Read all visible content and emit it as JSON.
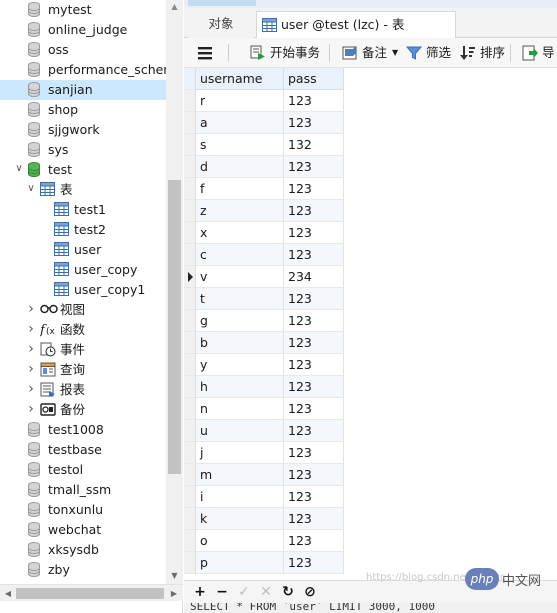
{
  "navigator": {
    "nodes": [
      {
        "label": "mytest",
        "icon": "database-icon",
        "level": 0
      },
      {
        "label": "online_judge",
        "icon": "database-icon",
        "level": 0
      },
      {
        "label": "oss",
        "icon": "database-icon",
        "level": 0
      },
      {
        "label": "performance_schen",
        "icon": "database-icon",
        "level": 0
      },
      {
        "label": "sanjian",
        "icon": "database-icon",
        "level": 0,
        "selected": true
      },
      {
        "label": "shop",
        "icon": "database-icon",
        "level": 0
      },
      {
        "label": "sjjgwork",
        "icon": "database-icon",
        "level": 0
      },
      {
        "label": "sys",
        "icon": "database-icon",
        "level": 0
      },
      {
        "label": "test",
        "icon": "database-open-icon",
        "level": 0,
        "expanded": true
      },
      {
        "label": "表",
        "icon": "tables-folder-icon",
        "level": 1,
        "expanded": true
      },
      {
        "label": "test1",
        "icon": "table-icon",
        "level": 2
      },
      {
        "label": "test2",
        "icon": "table-icon",
        "level": 2
      },
      {
        "label": "user",
        "icon": "table-icon",
        "level": 2
      },
      {
        "label": "user_copy",
        "icon": "table-icon",
        "level": 2
      },
      {
        "label": "user_copy1",
        "icon": "table-icon",
        "level": 2
      },
      {
        "label": "视图",
        "icon": "views-icon",
        "level": 1,
        "collapsed": true
      },
      {
        "label": "函数",
        "icon": "function-icon",
        "level": 1,
        "collapsed": true
      },
      {
        "label": "事件",
        "icon": "event-icon",
        "level": 1,
        "collapsed": true
      },
      {
        "label": "查询",
        "icon": "query-icon",
        "level": 1,
        "collapsed": true
      },
      {
        "label": "报表",
        "icon": "report-icon",
        "level": 1,
        "collapsed": true
      },
      {
        "label": "备份",
        "icon": "backup-icon",
        "level": 1,
        "collapsed": true
      },
      {
        "label": "test1008",
        "icon": "database-icon",
        "level": 0
      },
      {
        "label": "testbase",
        "icon": "database-icon",
        "level": 0
      },
      {
        "label": "testol",
        "icon": "database-icon",
        "level": 0
      },
      {
        "label": "tmall_ssm",
        "icon": "database-icon",
        "level": 0
      },
      {
        "label": "tonxunlu",
        "icon": "database-icon",
        "level": 0
      },
      {
        "label": "webchat",
        "icon": "database-icon",
        "level": 0
      },
      {
        "label": "xksysdb",
        "icon": "database-icon",
        "level": 0
      },
      {
        "label": "zby",
        "icon": "database-icon",
        "level": 0
      }
    ]
  },
  "tabs": {
    "objects_label": "对象",
    "active_label": "user @test (lzc) - 表"
  },
  "toolbar": {
    "menu_icon": "hamburger-icon",
    "begin_transaction": "开始事务",
    "memo": "备注",
    "filter": "筛选",
    "sort": "排序",
    "export": "导"
  },
  "grid": {
    "columns": [
      "username",
      "pass"
    ],
    "current_row": 8,
    "rows": [
      [
        "r",
        "123"
      ],
      [
        "a",
        "123"
      ],
      [
        "s",
        "132"
      ],
      [
        "d",
        "123"
      ],
      [
        "f",
        "123"
      ],
      [
        "z",
        "123"
      ],
      [
        "x",
        "123"
      ],
      [
        "c",
        "123"
      ],
      [
        "v",
        "234"
      ],
      [
        "t",
        "123"
      ],
      [
        "g",
        "123"
      ],
      [
        "b",
        "123"
      ],
      [
        "y",
        "123"
      ],
      [
        "h",
        "123"
      ],
      [
        "n",
        "123"
      ],
      [
        "u",
        "123"
      ],
      [
        "j",
        "123"
      ],
      [
        "m",
        "123"
      ],
      [
        "i",
        "123"
      ],
      [
        "k",
        "123"
      ],
      [
        "o",
        "123"
      ],
      [
        "p",
        "123"
      ]
    ]
  },
  "bottombar": {
    "add": "+",
    "remove": "−",
    "apply": "✓",
    "discard": "✕",
    "refresh": "↻",
    "stop": "⊘"
  },
  "status": {
    "sql": "SELECT * FROM `user` LIMIT 3000, 1000"
  },
  "watermark": {
    "url": "https://blog.csdn.net/jtnxizc",
    "php": "php",
    "site": "中文网"
  }
}
